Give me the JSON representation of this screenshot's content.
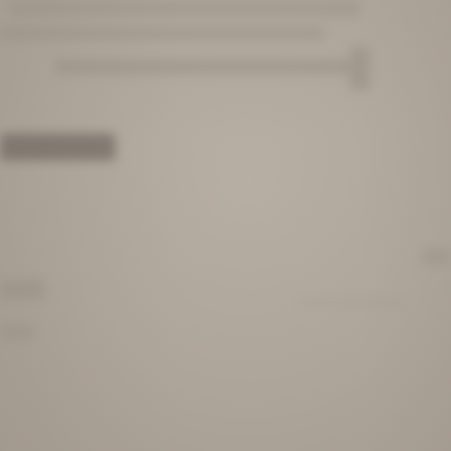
{
  "scene": {
    "description_colors": {
      "background": "#b2a99e",
      "text_smudge": "#6f6860"
    }
  }
}
